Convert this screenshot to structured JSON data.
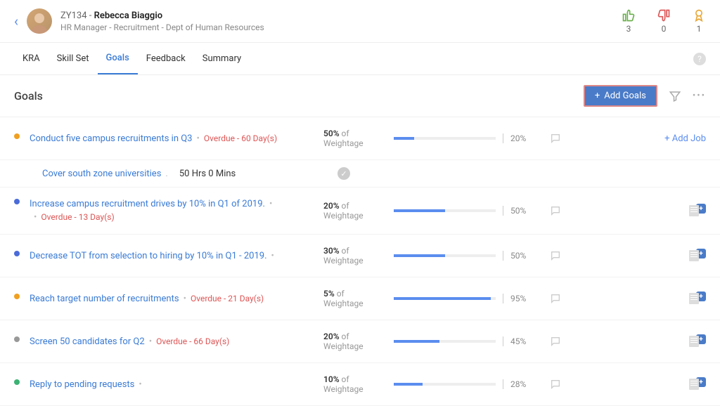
{
  "user": {
    "id": "ZY134",
    "sep": " - ",
    "name": "Rebecca Biaggio",
    "title": "HR Manager - Recruitment - Dept of Human Resources"
  },
  "stats": {
    "thumbs_up": "3",
    "thumbs_down": "0",
    "award": "1"
  },
  "tabs": [
    "KRA",
    "Skill Set",
    "Goals",
    "Feedback",
    "Summary"
  ],
  "active_tab_index": 2,
  "page_title": "Goals",
  "add_goals_label": "Add Goals",
  "add_job_label": "+ Add Job",
  "of_label": " of",
  "weightage_label": "Weightage",
  "goals": [
    {
      "bullet": "#f0a020",
      "title": "Conduct five campus recruitments in Q3",
      "overdue": "Overdue - 60 Day(s)",
      "wpct": "50%",
      "progress": 20,
      "ptxt": "20%",
      "action": "addjob"
    },
    {
      "sub": true,
      "title": "Cover south zone universities",
      "time": "50 Hrs 0 Mins"
    },
    {
      "bullet": "#4a6bd8",
      "title": "Increase campus recruitment drives by 10% in Q1 of 2019.",
      "overdue": "Overdue - 13 Day(s)",
      "overdue_below": true,
      "wpct": "20%",
      "progress": 50,
      "ptxt": "50%",
      "action": "docplus"
    },
    {
      "bullet": "#4a6bd8",
      "title": "Decrease TOT from selection to hiring by 10% in Q1 - 2019.",
      "wpct": "30%",
      "progress": 50,
      "ptxt": "50%",
      "action": "docplus"
    },
    {
      "bullet": "#f0a020",
      "title": "Reach target number of recruitments",
      "overdue": "Overdue - 21 Day(s)",
      "wpct": "5%",
      "progress": 95,
      "ptxt": "95%",
      "action": "docplus"
    },
    {
      "bullet": "#999",
      "title": "Screen 50 candidates for Q2",
      "overdue": "Overdue - 66 Day(s)",
      "wpct": "20%",
      "progress": 45,
      "ptxt": "45%",
      "action": "docplus"
    },
    {
      "bullet": "#3bb273",
      "title": "Reply to pending requests",
      "wpct": "10%",
      "progress": 28,
      "ptxt": "28%",
      "action": "docplus"
    }
  ]
}
